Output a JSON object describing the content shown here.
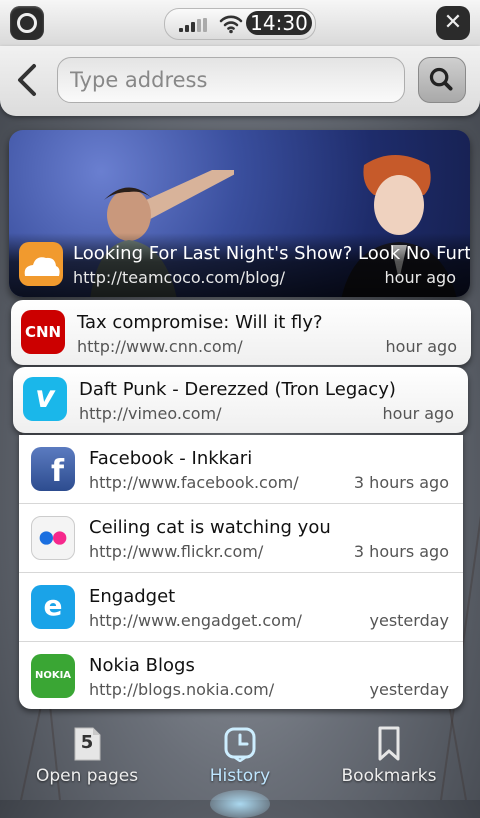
{
  "status_bar": {
    "time": "14:30",
    "close_glyph": "✕"
  },
  "address_bar": {
    "placeholder": "Type address",
    "back_icon": "chevron-left-icon",
    "search_icon": "search-icon"
  },
  "featured": {
    "title": "Looking For Last Night's Show? Look No Further",
    "url": "http://teamcoco.com/blog/",
    "time": "hour ago"
  },
  "cards": [
    {
      "title": "Tax compromise: Will it fly?",
      "url": "http://www.cnn.com/",
      "time": "hour ago",
      "favicon_text": "CNN",
      "color": "#cc0000"
    },
    {
      "title": "Daft Punk - Derezzed (Tron Legacy)",
      "url": "http://vimeo.com/",
      "time": "hour ago",
      "favicon_text": "v",
      "color": "#1ab7ea"
    }
  ],
  "list": [
    {
      "title": "Facebook - Inkkari",
      "url": "http://www.facebook.com/",
      "time": "3 hours ago",
      "favicon_text": "f",
      "color": "#3b5998"
    },
    {
      "title": "Ceiling cat is watching you",
      "url": "http://www.flickr.com/",
      "time": "3 hours ago",
      "favicon_text": "",
      "color": "#f4f4f4"
    },
    {
      "title": "Engadget",
      "url": "http://www.engadget.com/",
      "time": "yesterday",
      "favicon_text": "e",
      "color": "#1aa3e8"
    },
    {
      "title": "Nokia Blogs",
      "url": "http://blogs.nokia.com/",
      "time": "yesterday",
      "favicon_text": "NOKIA",
      "color": "#3aa634"
    }
  ],
  "toolbar": {
    "open_pages_label": "Open pages",
    "open_pages_count": "5",
    "history_label": "History",
    "bookmarks_label": "Bookmarks",
    "active_color": "#bfe6ff"
  }
}
